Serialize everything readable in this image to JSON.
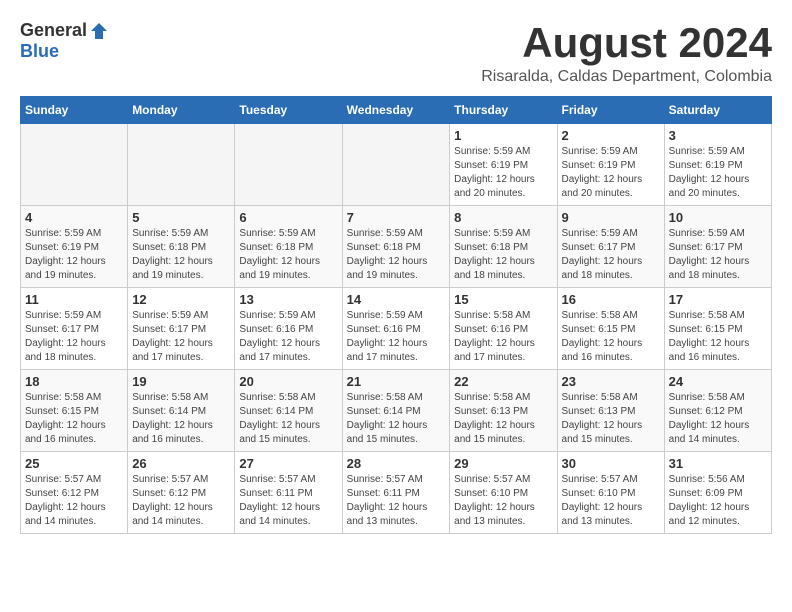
{
  "header": {
    "logo_general": "General",
    "logo_blue": "Blue",
    "month_title": "August 2024",
    "location": "Risaralda, Caldas Department, Colombia"
  },
  "calendar": {
    "days_of_week": [
      "Sunday",
      "Monday",
      "Tuesday",
      "Wednesday",
      "Thursday",
      "Friday",
      "Saturday"
    ],
    "weeks": [
      {
        "days": [
          {
            "number": "",
            "info": ""
          },
          {
            "number": "",
            "info": ""
          },
          {
            "number": "",
            "info": ""
          },
          {
            "number": "",
            "info": ""
          },
          {
            "number": "1",
            "info": "Sunrise: 5:59 AM\nSunset: 6:19 PM\nDaylight: 12 hours\nand 20 minutes."
          },
          {
            "number": "2",
            "info": "Sunrise: 5:59 AM\nSunset: 6:19 PM\nDaylight: 12 hours\nand 20 minutes."
          },
          {
            "number": "3",
            "info": "Sunrise: 5:59 AM\nSunset: 6:19 PM\nDaylight: 12 hours\nand 20 minutes."
          }
        ]
      },
      {
        "days": [
          {
            "number": "4",
            "info": "Sunrise: 5:59 AM\nSunset: 6:19 PM\nDaylight: 12 hours\nand 19 minutes."
          },
          {
            "number": "5",
            "info": "Sunrise: 5:59 AM\nSunset: 6:18 PM\nDaylight: 12 hours\nand 19 minutes."
          },
          {
            "number": "6",
            "info": "Sunrise: 5:59 AM\nSunset: 6:18 PM\nDaylight: 12 hours\nand 19 minutes."
          },
          {
            "number": "7",
            "info": "Sunrise: 5:59 AM\nSunset: 6:18 PM\nDaylight: 12 hours\nand 19 minutes."
          },
          {
            "number": "8",
            "info": "Sunrise: 5:59 AM\nSunset: 6:18 PM\nDaylight: 12 hours\nand 18 minutes."
          },
          {
            "number": "9",
            "info": "Sunrise: 5:59 AM\nSunset: 6:17 PM\nDaylight: 12 hours\nand 18 minutes."
          },
          {
            "number": "10",
            "info": "Sunrise: 5:59 AM\nSunset: 6:17 PM\nDaylight: 12 hours\nand 18 minutes."
          }
        ]
      },
      {
        "days": [
          {
            "number": "11",
            "info": "Sunrise: 5:59 AM\nSunset: 6:17 PM\nDaylight: 12 hours\nand 18 minutes."
          },
          {
            "number": "12",
            "info": "Sunrise: 5:59 AM\nSunset: 6:17 PM\nDaylight: 12 hours\nand 17 minutes."
          },
          {
            "number": "13",
            "info": "Sunrise: 5:59 AM\nSunset: 6:16 PM\nDaylight: 12 hours\nand 17 minutes."
          },
          {
            "number": "14",
            "info": "Sunrise: 5:59 AM\nSunset: 6:16 PM\nDaylight: 12 hours\nand 17 minutes."
          },
          {
            "number": "15",
            "info": "Sunrise: 5:58 AM\nSunset: 6:16 PM\nDaylight: 12 hours\nand 17 minutes."
          },
          {
            "number": "16",
            "info": "Sunrise: 5:58 AM\nSunset: 6:15 PM\nDaylight: 12 hours\nand 16 minutes."
          },
          {
            "number": "17",
            "info": "Sunrise: 5:58 AM\nSunset: 6:15 PM\nDaylight: 12 hours\nand 16 minutes."
          }
        ]
      },
      {
        "days": [
          {
            "number": "18",
            "info": "Sunrise: 5:58 AM\nSunset: 6:15 PM\nDaylight: 12 hours\nand 16 minutes."
          },
          {
            "number": "19",
            "info": "Sunrise: 5:58 AM\nSunset: 6:14 PM\nDaylight: 12 hours\nand 16 minutes."
          },
          {
            "number": "20",
            "info": "Sunrise: 5:58 AM\nSunset: 6:14 PM\nDaylight: 12 hours\nand 15 minutes."
          },
          {
            "number": "21",
            "info": "Sunrise: 5:58 AM\nSunset: 6:14 PM\nDaylight: 12 hours\nand 15 minutes."
          },
          {
            "number": "22",
            "info": "Sunrise: 5:58 AM\nSunset: 6:13 PM\nDaylight: 12 hours\nand 15 minutes."
          },
          {
            "number": "23",
            "info": "Sunrise: 5:58 AM\nSunset: 6:13 PM\nDaylight: 12 hours\nand 15 minutes."
          },
          {
            "number": "24",
            "info": "Sunrise: 5:58 AM\nSunset: 6:12 PM\nDaylight: 12 hours\nand 14 minutes."
          }
        ]
      },
      {
        "days": [
          {
            "number": "25",
            "info": "Sunrise: 5:57 AM\nSunset: 6:12 PM\nDaylight: 12 hours\nand 14 minutes."
          },
          {
            "number": "26",
            "info": "Sunrise: 5:57 AM\nSunset: 6:12 PM\nDaylight: 12 hours\nand 14 minutes."
          },
          {
            "number": "27",
            "info": "Sunrise: 5:57 AM\nSunset: 6:11 PM\nDaylight: 12 hours\nand 14 minutes."
          },
          {
            "number": "28",
            "info": "Sunrise: 5:57 AM\nSunset: 6:11 PM\nDaylight: 12 hours\nand 13 minutes."
          },
          {
            "number": "29",
            "info": "Sunrise: 5:57 AM\nSunset: 6:10 PM\nDaylight: 12 hours\nand 13 minutes."
          },
          {
            "number": "30",
            "info": "Sunrise: 5:57 AM\nSunset: 6:10 PM\nDaylight: 12 hours\nand 13 minutes."
          },
          {
            "number": "31",
            "info": "Sunrise: 5:56 AM\nSunset: 6:09 PM\nDaylight: 12 hours\nand 12 minutes."
          }
        ]
      }
    ]
  }
}
